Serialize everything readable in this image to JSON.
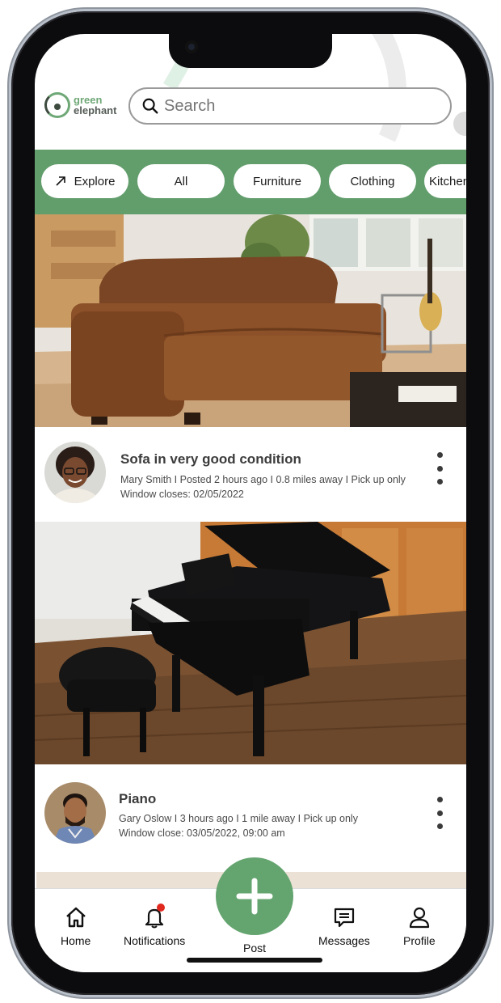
{
  "brand": {
    "line1": "green",
    "line2": "elephant"
  },
  "search": {
    "placeholder": "Search"
  },
  "categories": [
    {
      "label": "Explore",
      "icon": "arrow-up-right-icon"
    },
    {
      "label": "All"
    },
    {
      "label": "Furniture"
    },
    {
      "label": "Clothing"
    },
    {
      "label": "Kitchen"
    }
  ],
  "listings": [
    {
      "title": "Sofa in very good condition",
      "meta_line1": "Mary Smith  I  Posted 2 hours ago I 0.8 miles away I   Pick up only",
      "meta_line2": "Window closes: 02/05/2022",
      "image": "leather-sofa-photo"
    },
    {
      "title": "Piano",
      "meta_line1": "Gary Oslow     I     3 hours ago     I     1 mile away     I     Pick up only",
      "meta_line2": "Window close: 03/05/2022, 09:00 am",
      "image": "grand-piano-photo"
    }
  ],
  "tabbar": {
    "home": "Home",
    "notifications": "Notifications",
    "post": "Post",
    "messages": "Messages",
    "profile": "Profile"
  },
  "colors": {
    "brand_green": "#629d6c",
    "notification_red": "#e0281e"
  }
}
